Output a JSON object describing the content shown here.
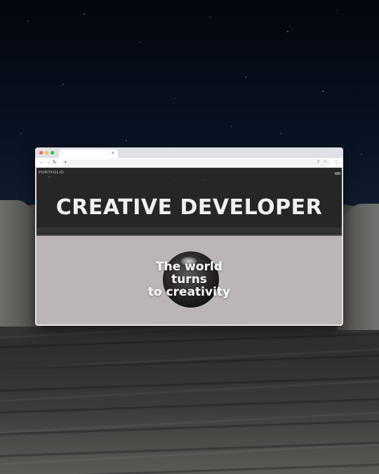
{
  "browser": {
    "tab_close": "×",
    "nav": {
      "back": "←",
      "forward": "→",
      "reload": "↻"
    },
    "address_icons": {
      "lock": "lock-icon",
      "share": "share-icon",
      "bookmark": "bookmark-icon"
    },
    "menu": "⋮"
  },
  "site": {
    "logo": "PORTFOLIO",
    "logo_sub": "2.0",
    "nav_items": [
      "intro",
      "work",
      "skills",
      "about",
      "contact"
    ],
    "hero_title": "CREATIVE DEVELOPER",
    "tagline": [
      "The world",
      "turns",
      "to creativity"
    ]
  },
  "colors": {
    "accent_red": "#c0392b",
    "content_bg": "#bbb5b6"
  }
}
